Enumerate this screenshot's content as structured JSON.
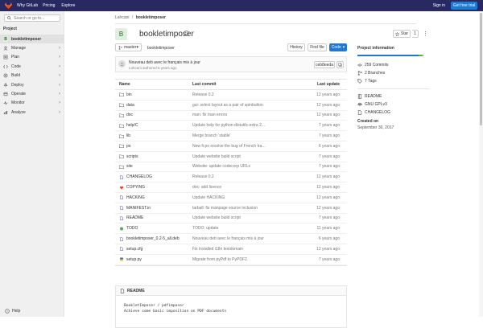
{
  "topbar": {
    "why": "Why GitLab",
    "pricing": "Pricing",
    "explore": "Explore",
    "signin": "Sign in",
    "freetrial": "Get free trial"
  },
  "sidebar": {
    "search_placeholder": "Search or go to...",
    "project_header": "Project",
    "items": [
      {
        "label": "bookletimposer",
        "icon": "B",
        "active": true,
        "chevron": false
      },
      {
        "label": "Manage",
        "icon": "manage-icon",
        "chevron": true
      },
      {
        "label": "Plan",
        "icon": "plan-icon",
        "chevron": true
      },
      {
        "label": "Code",
        "icon": "code-icon",
        "chevron": true
      },
      {
        "label": "Build",
        "icon": "build-icon",
        "chevron": true
      },
      {
        "label": "Deploy",
        "icon": "deploy-icon",
        "chevron": true
      },
      {
        "label": "Operate",
        "icon": "operate-icon",
        "chevron": true
      },
      {
        "label": "Monitor",
        "icon": "monitor-icon",
        "chevron": true
      },
      {
        "label": "Analyze",
        "icon": "analyze-icon",
        "chevron": true
      }
    ],
    "help": "Help"
  },
  "breadcrumb": {
    "group": "Lahcani",
    "sep": "/",
    "project": "bookletimposer"
  },
  "project": {
    "avatar_letter": "B",
    "title": "bookletimposer",
    "star_label": "Star",
    "star_count": "1"
  },
  "repo_bar": {
    "branch": "master",
    "path": "bookletimposer",
    "history": "History",
    "find_file": "Find file",
    "code": "Code"
  },
  "last_commit": {
    "message": "Nouveau deb avec le français mis à jour",
    "author": "Lahcani authored 6 years ago",
    "sha": "ceb8eeda"
  },
  "files": {
    "headers": {
      "name": "Name",
      "commit": "Last commit",
      "update": "Last update"
    },
    "rows": [
      {
        "name": "bin",
        "type": "folder",
        "commit": "Release 0.2",
        "update": "12 years ago"
      },
      {
        "name": "data",
        "type": "folder",
        "commit": "gui: select layout as a pair of spinbutton",
        "update": "12 years ago"
      },
      {
        "name": "doc",
        "type": "folder",
        "commit": "man: fix man errors",
        "update": "12 years ago"
      },
      {
        "name": "help/C",
        "type": "folder",
        "commit": "Update help for python-distutils-extra 2...",
        "update": "7 years ago"
      },
      {
        "name": "lib",
        "type": "folder",
        "commit": "Merge branch 'stable'",
        "update": "7 years ago"
      },
      {
        "name": "po",
        "type": "folder",
        "commit": "New fr.po resolve the bug of French tra...",
        "update": "6 years ago"
      },
      {
        "name": "scripts",
        "type": "folder",
        "commit": "Update website build script",
        "update": "7 years ago"
      },
      {
        "name": "site",
        "type": "folder",
        "commit": "Website: update codecorp URLs",
        "update": "7 years ago"
      },
      {
        "name": "CHANGELOG",
        "type": "file",
        "commit": "Release 0.2",
        "update": "12 years ago"
      },
      {
        "name": "COPYING",
        "type": "license",
        "commit": "doc: add licence",
        "update": "12 years ago"
      },
      {
        "name": "HACKING",
        "type": "file",
        "commit": "Update HACKING",
        "update": "12 years ago"
      },
      {
        "name": "MANIFEST.in",
        "type": "file",
        "commit": "tarball: fix manpage source inclusion",
        "update": "12 years ago"
      },
      {
        "name": "README",
        "type": "file",
        "commit": "Update website build script",
        "update": "7 years ago"
      },
      {
        "name": "TODO",
        "type": "todo",
        "commit": "TODO: update",
        "update": "11 years ago"
      },
      {
        "name": "bookletimposer_0.2-5_all.deb",
        "type": "file",
        "commit": "Nouveau deb avec le français mis à jour",
        "update": "6 years ago"
      },
      {
        "name": "setup.cfg",
        "type": "file",
        "commit": "Fix installed i18n testdomain",
        "update": "12 years ago"
      },
      {
        "name": "setup.py",
        "type": "python",
        "commit": "Migrate from pyPdf to PyPDF2.",
        "update": "7 years ago"
      }
    ]
  },
  "readme": {
    "header": "README",
    "line1": "BookletImposer / pdfimposer",
    "line2": "Achieve some basic imposition on PDF documents"
  },
  "info": {
    "title": "Project information",
    "commits": "259 Commits",
    "branches": "2 Branches",
    "tags": "7 Tags",
    "readme": "README",
    "license": "GNU GPLv3",
    "changelog": "CHANGELOG",
    "created_label": "Created on",
    "created_date": "September 30, 2017"
  },
  "colors": {
    "topbar": "#292961",
    "accent": "#1f78d1"
  }
}
